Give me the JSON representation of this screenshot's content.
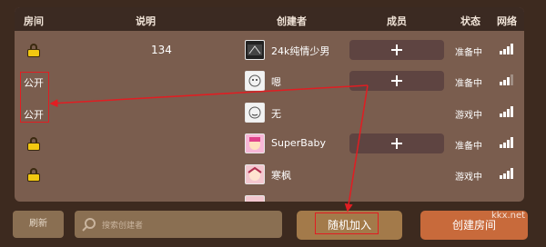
{
  "header": {
    "room": "房间",
    "desc": "说明",
    "creator": "创建者",
    "members": "成员",
    "status": "状态",
    "network": "网络"
  },
  "rows": [
    {
      "room_type": "lock",
      "room_label": "",
      "desc": "134",
      "creator": "24k纯情少男",
      "has_join": true,
      "status": "准备中",
      "signal": 4
    },
    {
      "room_type": "text",
      "room_label": "公开",
      "desc": "",
      "creator": "嗯",
      "has_join": true,
      "status": "准备中",
      "signal": 3
    },
    {
      "room_type": "text",
      "room_label": "公开",
      "desc": "",
      "creator": "无",
      "has_join": false,
      "status": "游戏中",
      "signal": 4
    },
    {
      "room_type": "lock",
      "room_label": "",
      "desc": "",
      "creator": "SuperBaby",
      "has_join": true,
      "status": "准备中",
      "signal": 4
    },
    {
      "room_type": "lock",
      "room_label": "",
      "desc": "",
      "creator": "寒枫",
      "has_join": false,
      "status": "游戏中",
      "signal": 4
    }
  ],
  "bottom": {
    "refresh": "刷新",
    "search_placeholder": "搜索创建者",
    "random_join": "随机加入",
    "create_room": "创建房间"
  },
  "watermark": "kkx.net",
  "colors": {
    "panel": "#7a5d4e",
    "header": "#3b2a22",
    "join_button": "#5e4441",
    "random_button": "#a37a4a",
    "create_button": "#c86a3b",
    "lock_icon": "#f2c811",
    "annotation": "#e11d22"
  }
}
